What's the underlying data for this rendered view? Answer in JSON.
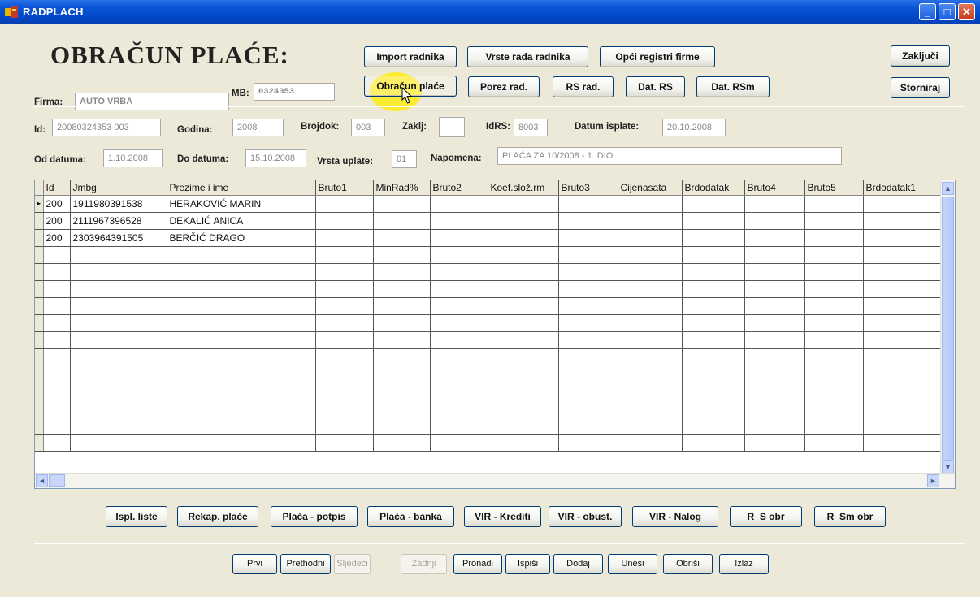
{
  "window": {
    "title": "RADPLACH",
    "minimize": "_",
    "maximize": "□",
    "close": "✕"
  },
  "header": {
    "title": "OBRAČUN PLAĆE:",
    "firma_label": "Firma:",
    "firma_value": "AUTO VRBA",
    "mb_label": "MB:",
    "mb_value": "0324353"
  },
  "toolbar_top": {
    "import_radnika": "Import radnika",
    "vrste_rada": "Vrste rada radnika",
    "opci_registri": "Opći registri firme",
    "zakljuci": "Zaključi",
    "obracun_place": "Obračun plaće",
    "porez_rad": "Porez rad.",
    "rs_rad": "RS rad.",
    "dat_rs": "Dat. RS",
    "dat_rsm": "Dat. RSm",
    "storniraj": "Storniraj"
  },
  "form": {
    "id_label": "Id:",
    "id_value": "20080324353    003",
    "godina_label": "Godina:",
    "godina_value": "2008",
    "brojdok_label": "Brojdok:",
    "brojdok_value": "003",
    "zaklj_label": "Zaklj:",
    "zaklj_value": "",
    "idrs_label": "IdRS:",
    "idrs_value": "8003",
    "datum_isplate_label": "Datum isplate:",
    "datum_isplate_value": "20.10.2008",
    "od_datuma_label": "Od datuma:",
    "od_datuma_value": "1.10.2008",
    "do_datuma_label": "Do datuma:",
    "do_datuma_value": "15.10.2008",
    "vrsta_uplate_label": "Vrsta uplate:",
    "vrsta_uplate_value": "01",
    "napomena_label": "Napomena:",
    "napomena_value": "PLAĆA ZA 10/2008 - 1. DIO"
  },
  "grid": {
    "columns": [
      "Id",
      "Jmbg",
      "Prezime i ime",
      "Bruto1",
      "MinRad%",
      "Bruto2",
      "Koef.slož.rm",
      "Bruto3",
      "Cijenasata",
      "Brdodatak",
      "Bruto4",
      "Bruto5",
      "Brdodatak1"
    ],
    "rows": [
      [
        "200",
        "1911980391538",
        "HERAKOVIĆ MARIN"
      ],
      [
        "200",
        "2111967396528",
        "DEKALIĆ ANICA"
      ],
      [
        "200",
        "2303964391505",
        "BERČIĆ DRAGO"
      ]
    ],
    "current_row_marker": "►"
  },
  "reports": {
    "ispl_liste": "Ispl. liste",
    "rekap_place": "Rekap. plaće",
    "placa_potpis": "Plaća - potpis",
    "placa_banka": "Plaća - banka",
    "vir_krediti": "VIR - Krediti",
    "vir_obust": "VIR - obust.",
    "vir_nalog": "VIR - Nalog",
    "r_s_obr": "R_S obr",
    "r_sm_obr": "R_Sm obr"
  },
  "nav": {
    "prvi": "Prvi",
    "prethodni": "Prethodni",
    "sljedeci": "Sljedeći",
    "zadnji": "Zadnji",
    "pronadi": "Pronadi",
    "ispisi": "Ispiši",
    "dodaj": "Dodaj",
    "unesi": "Unesi",
    "obrisi": "Obriši",
    "izlaz": "Izlaz"
  },
  "colors": {
    "titlebar": "#0046c8",
    "background": "#ece9d8",
    "highlight": "#ffeb14"
  }
}
